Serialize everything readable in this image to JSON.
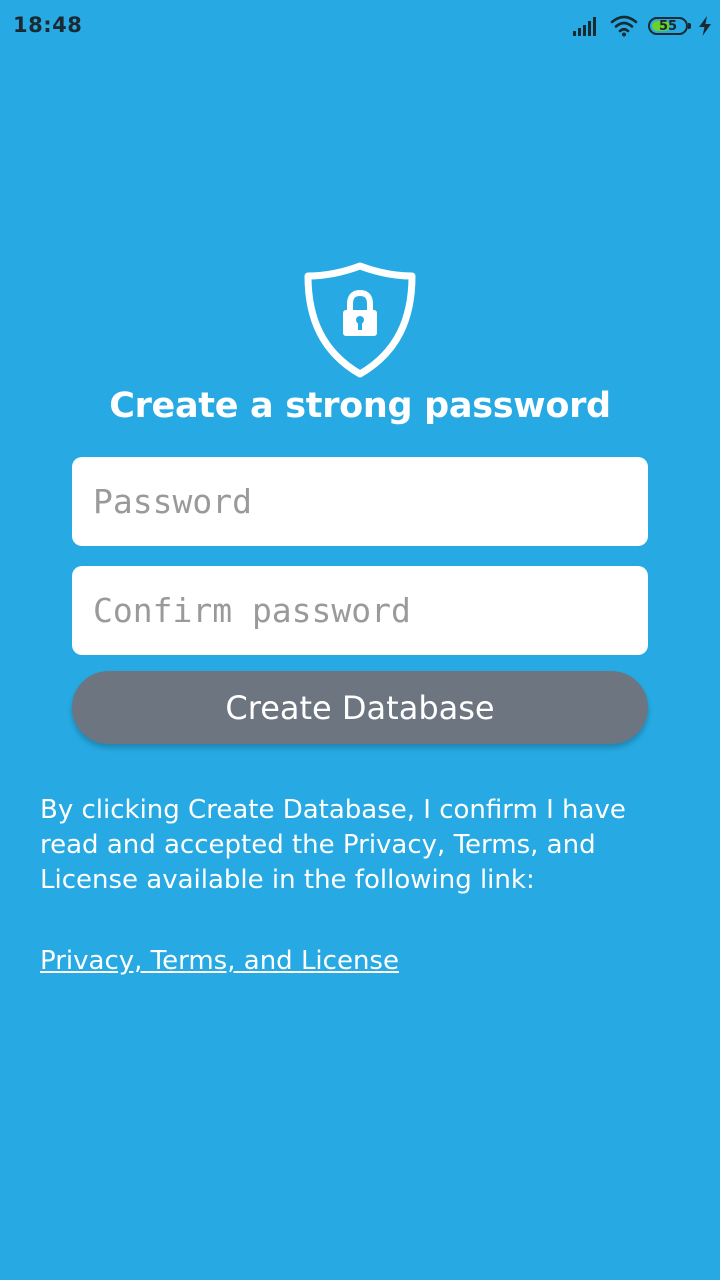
{
  "status_bar": {
    "time": "18:48",
    "battery_level": "55",
    "battery_fraction": 0.55,
    "icons": [
      "signal-icon",
      "wifi-icon",
      "battery-icon",
      "charging-icon"
    ]
  },
  "header": {
    "icon": "shield-lock-icon",
    "title": "Create a strong password"
  },
  "form": {
    "password_placeholder": "Password",
    "password_value": "",
    "confirm_placeholder": "Confirm password",
    "confirm_value": "",
    "submit_label": "Create Database"
  },
  "legal": {
    "disclaimer": "By clicking Create Database, I confirm I have read and accepted the Privacy, Terms, and License available in the following link:",
    "link_label": "Privacy, Terms, and License"
  },
  "colors": {
    "background": "#27aae3",
    "button": "#6d7581",
    "battery_fill": "#6bd12a"
  }
}
